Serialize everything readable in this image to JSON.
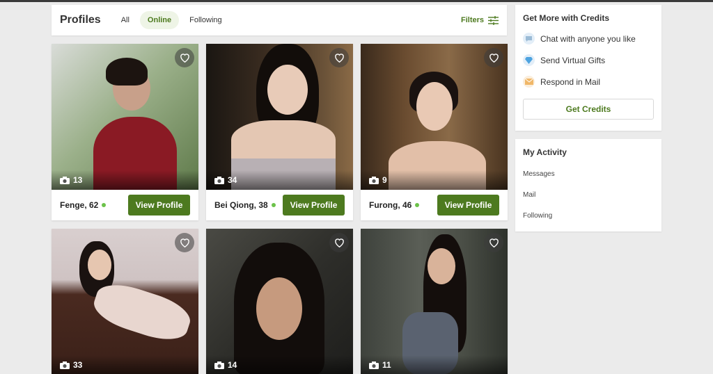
{
  "header": {
    "title": "Profiles",
    "tabs": [
      {
        "label": "All",
        "active": false
      },
      {
        "label": "Online",
        "active": true
      },
      {
        "label": "Following",
        "active": false
      }
    ],
    "filters_label": "Filters"
  },
  "profiles": [
    {
      "name": "Fenge, 62",
      "photos": "13",
      "online": true,
      "button": "View Profile"
    },
    {
      "name": "Bei Qiong, 38",
      "photos": "34",
      "online": true,
      "button": "View Profile"
    },
    {
      "name": "Furong, 46",
      "photos": "9",
      "online": true,
      "button": "View Profile"
    },
    {
      "name": "",
      "photos": "33",
      "online": false,
      "button": ""
    },
    {
      "name": "",
      "photos": "14",
      "online": false,
      "button": ""
    },
    {
      "name": "",
      "photos": "11",
      "online": false,
      "button": ""
    }
  ],
  "credits": {
    "title": "Get More with Credits",
    "perks": [
      {
        "label": "Chat with anyone you like",
        "icon": "chat-bubble-icon"
      },
      {
        "label": "Send Virtual Gifts",
        "icon": "diamond-icon"
      },
      {
        "label": "Respond in Mail",
        "icon": "envelope-icon"
      }
    ],
    "button": "Get Credits"
  },
  "activity": {
    "title": "My Activity",
    "items": [
      "Messages",
      "Mail",
      "Following"
    ]
  },
  "colors": {
    "accent": "#4d7a1f",
    "online": "#6cc24a",
    "background": "#ebebeb"
  }
}
